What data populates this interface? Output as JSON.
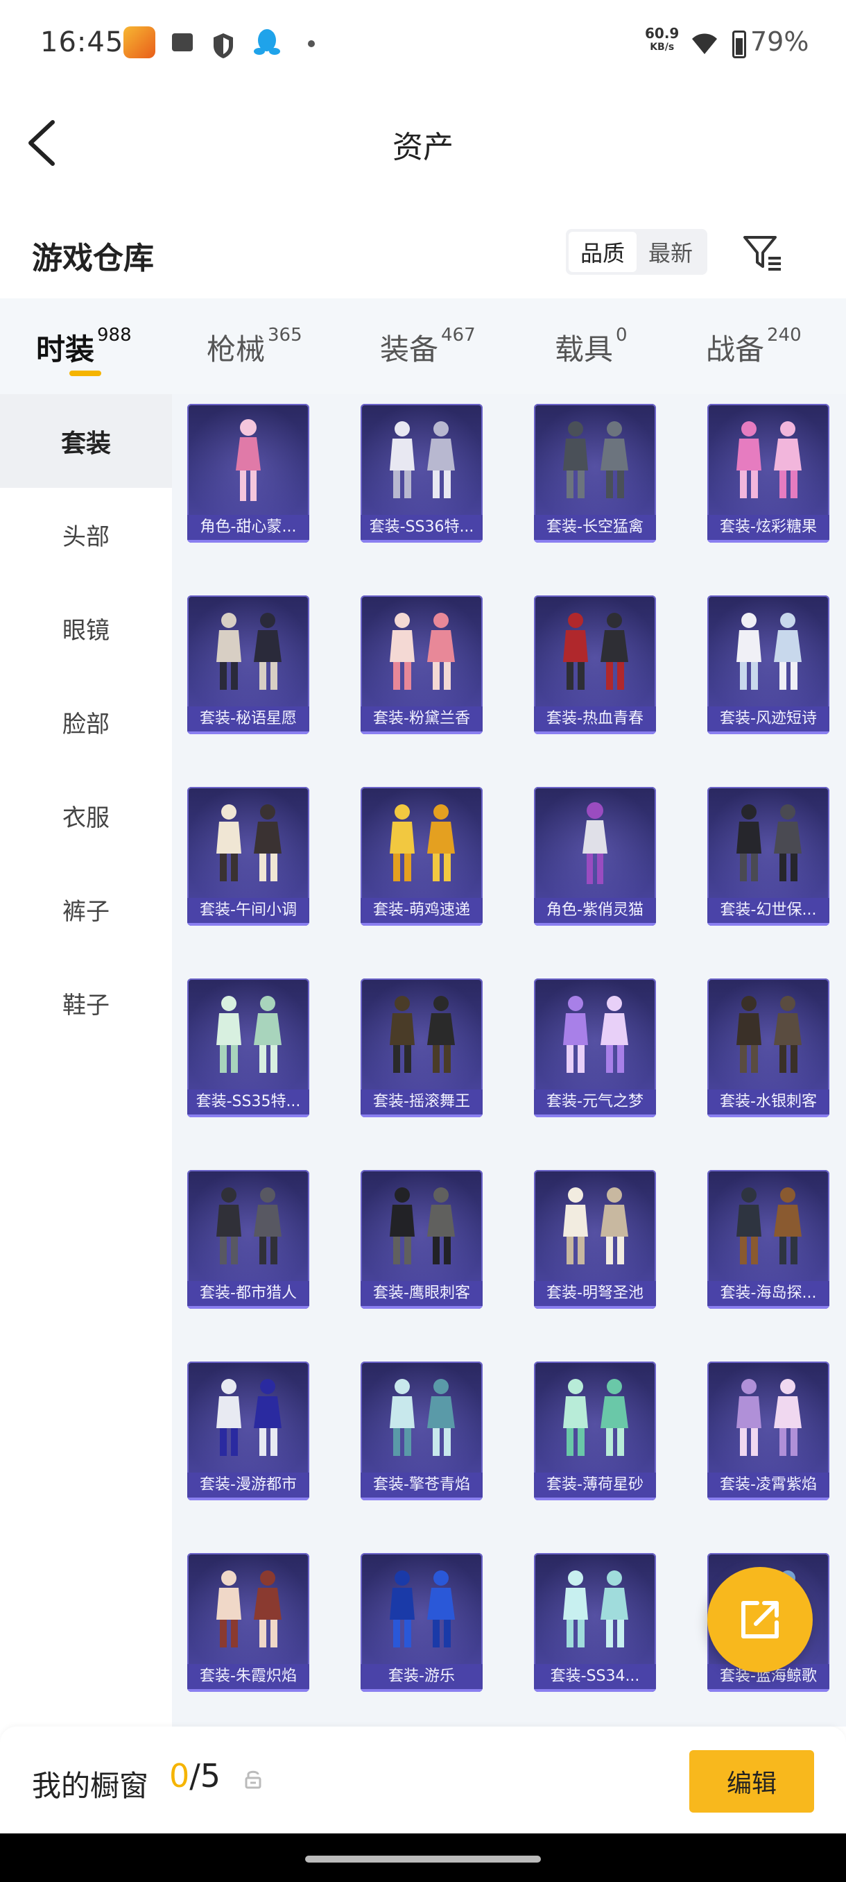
{
  "status_bar": {
    "time": "16:45",
    "net_speed": "60.9",
    "net_unit": "KB/s",
    "battery": "79%",
    "icons": [
      "game-app-icon",
      "mail-icon",
      "shield-icon",
      "qq-penguin-icon",
      "dot-icon",
      "wifi-icon",
      "battery-icon"
    ]
  },
  "header": {
    "title": "资产",
    "back_icon": "chevron-left-icon"
  },
  "section": {
    "title": "游戏仓库",
    "sort_options": [
      "品质",
      "最新"
    ],
    "sort_selected": "品质",
    "filter_icon": "filter-icon"
  },
  "tabs": [
    {
      "label": "时装",
      "count": "988",
      "active": true
    },
    {
      "label": "枪械",
      "count": "365",
      "active": false
    },
    {
      "label": "装备",
      "count": "467",
      "active": false
    },
    {
      "label": "载具",
      "count": "0",
      "active": false
    },
    {
      "label": "战备",
      "count": "240",
      "active": false
    }
  ],
  "sidebar": [
    {
      "label": "套装",
      "active": true
    },
    {
      "label": "头部",
      "active": false
    },
    {
      "label": "眼镜",
      "active": false
    },
    {
      "label": "脸部",
      "active": false
    },
    {
      "label": "衣服",
      "active": false
    },
    {
      "label": "裤子",
      "active": false
    },
    {
      "label": "鞋子",
      "active": false
    }
  ],
  "items": [
    {
      "label": "角色-甜心蒙...",
      "art": "character-figure-pink"
    },
    {
      "label": "套装-SS36特...",
      "art": "outfit-set-white"
    },
    {
      "label": "套装-长空猛禽",
      "art": "outfit-camo-jacket"
    },
    {
      "label": "套装-炫彩糖果",
      "art": "outfit-set-pink"
    },
    {
      "label": "套装-秘语星愿",
      "art": "outfit-pair-dark"
    },
    {
      "label": "套装-粉黛兰香",
      "art": "outfit-pair-pink"
    },
    {
      "label": "套装-热血青春",
      "art": "outfit-red-jacket"
    },
    {
      "label": "套装-风迹短诗",
      "art": "outfit-pair-white"
    },
    {
      "label": "套装-午间小调",
      "art": "outfit-pair-beige"
    },
    {
      "label": "套装-萌鸡速递",
      "art": "outfit-chicken-yellow"
    },
    {
      "label": "角色-紫俏灵猫",
      "art": "character-figure-purple"
    },
    {
      "label": "套装-幻世保...",
      "art": "outfit-dark-suit"
    },
    {
      "label": "套装-SS35特...",
      "art": "outfit-set-mint"
    },
    {
      "label": "套装-摇滚舞王",
      "art": "outfit-rock-brown"
    },
    {
      "label": "套装-元气之梦",
      "art": "outfit-pair-purple"
    },
    {
      "label": "套装-水银刺客",
      "art": "outfit-dark-jacket"
    },
    {
      "label": "套装-都市猎人",
      "art": "outfit-urban-grey"
    },
    {
      "label": "套装-鹰眼刺客",
      "art": "outfit-hawk-black"
    },
    {
      "label": "套装-明弩圣池",
      "art": "outfit-pair-ivory"
    },
    {
      "label": "套装-海岛探...",
      "art": "outfit-island-vest"
    },
    {
      "label": "套装-漫游都市",
      "art": "outfit-pair-blue-white"
    },
    {
      "label": "套装-擎苍青焰",
      "art": "outfit-pair-teal"
    },
    {
      "label": "套装-薄荷星砂",
      "art": "outfit-pair-mint"
    },
    {
      "label": "套装-凌霄紫焰",
      "art": "outfit-pair-violet"
    },
    {
      "label": "套装-朱霞炽焰",
      "art": "outfit-pair-orange"
    },
    {
      "label": "套装-游乐",
      "art": "outfit-pair-royal-blue"
    },
    {
      "label": "套装-SS34...",
      "art": "outfit-set-aqua"
    },
    {
      "label": "套装-蓝海鲸歌",
      "art": "outfit-pair-sea"
    }
  ],
  "fab": {
    "icon": "share-export-icon"
  },
  "bottom_bar": {
    "label": "我的橱窗",
    "current": "0",
    "separator": "/",
    "total": "5",
    "lock_icon": "lock-icon",
    "edit_label": "编辑"
  },
  "colors": {
    "accent": "#f8b81d",
    "indicator": "#f5b400",
    "card_bg": "#3c3a86",
    "card_label_bg": "#4a43a8",
    "tab_bar_bg": "#f4f7fa",
    "grid_bg": "#f2f5f9"
  }
}
